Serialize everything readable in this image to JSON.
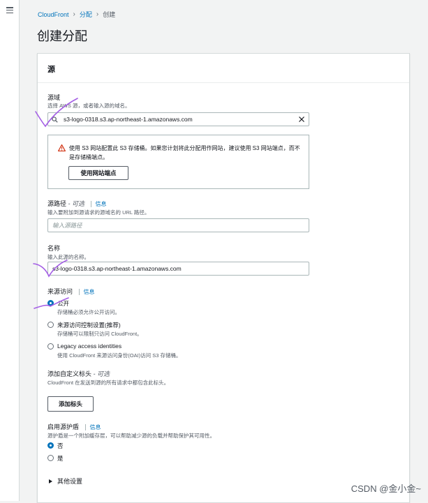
{
  "nav": {
    "menu_icon": "hamburger-icon"
  },
  "breadcrumb": {
    "root": "CloudFront",
    "section": "分配",
    "current": "创建"
  },
  "page": {
    "title": "创建分配"
  },
  "panel": {
    "title": "源"
  },
  "origin_domain": {
    "label": "源域",
    "description": "选择 AWS 源，或者输入源的域名。",
    "value": "s3-logo-0318.s3.ap-northeast-1.amazonaws.com"
  },
  "alert": {
    "text": "使用 S3 网站配置此 S3 存储桶。如果您计划将此分配用作网站，建议使用 S3 网站端点，而不是存储桶端点。",
    "button_label": "使用网站端点"
  },
  "origin_path": {
    "label": "源路径",
    "optional": "- 可选",
    "info": "信息",
    "description": "输入要附加到源请求的源域名的 URL 路径。",
    "placeholder": "输入源路径"
  },
  "name": {
    "label": "名称",
    "description": "输入此源的名称。",
    "value": "s3-logo-0318.s3.ap-northeast-1.amazonaws.com"
  },
  "origin_access": {
    "label": "来源访问",
    "info": "信息",
    "options": [
      {
        "label": "公开",
        "description": "存储桶必须允许公开访问。",
        "selected": true
      },
      {
        "label": "来源访问控制设置(推荐)",
        "description": "存储桶可以限制只访问 CloudFront。",
        "selected": false
      },
      {
        "label": "Legacy access identities",
        "description": "使用 CloudFront 来源访问身份(OAI)访问 S3 存储桶。",
        "selected": false
      }
    ]
  },
  "custom_headers": {
    "label": "添加自定义标头",
    "optional": "- 可选",
    "description": "CloudFront 在发送到源的所有请求中都包含此标头。",
    "button_label": "添加标头"
  },
  "origin_shield": {
    "label": "启用源护盾",
    "info": "信息",
    "description": "源护盾是一个附加缓存层，可以帮助减少源的负载并帮助保护其可用性。",
    "options": [
      {
        "label": "否",
        "selected": true
      },
      {
        "label": "是",
        "selected": false
      }
    ]
  },
  "additional_settings": {
    "label": "其他设置"
  },
  "watermark": "CSDN @金小金~",
  "colors": {
    "link": "#0073bb",
    "annotation": "#a45ee5",
    "warning": "#d13212"
  }
}
